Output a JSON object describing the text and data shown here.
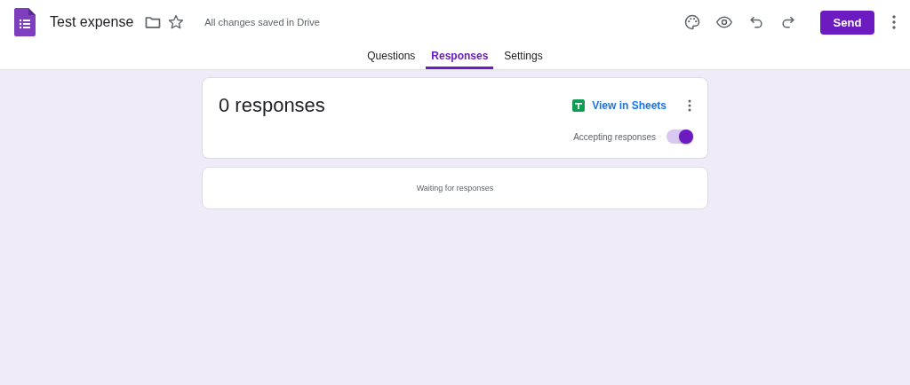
{
  "header": {
    "title": "Test expense",
    "save_status": "All changes saved in Drive",
    "send_label": "Send"
  },
  "tabs": [
    {
      "label": "Questions",
      "selected": false
    },
    {
      "label": "Responses",
      "selected": true
    },
    {
      "label": "Settings",
      "selected": false
    }
  ],
  "summary": {
    "count": "0 responses",
    "sheets_link": "View in Sheets",
    "accepting_label": "Accepting responses",
    "accepting_on": true
  },
  "status": {
    "message": "Waiting for responses"
  }
}
